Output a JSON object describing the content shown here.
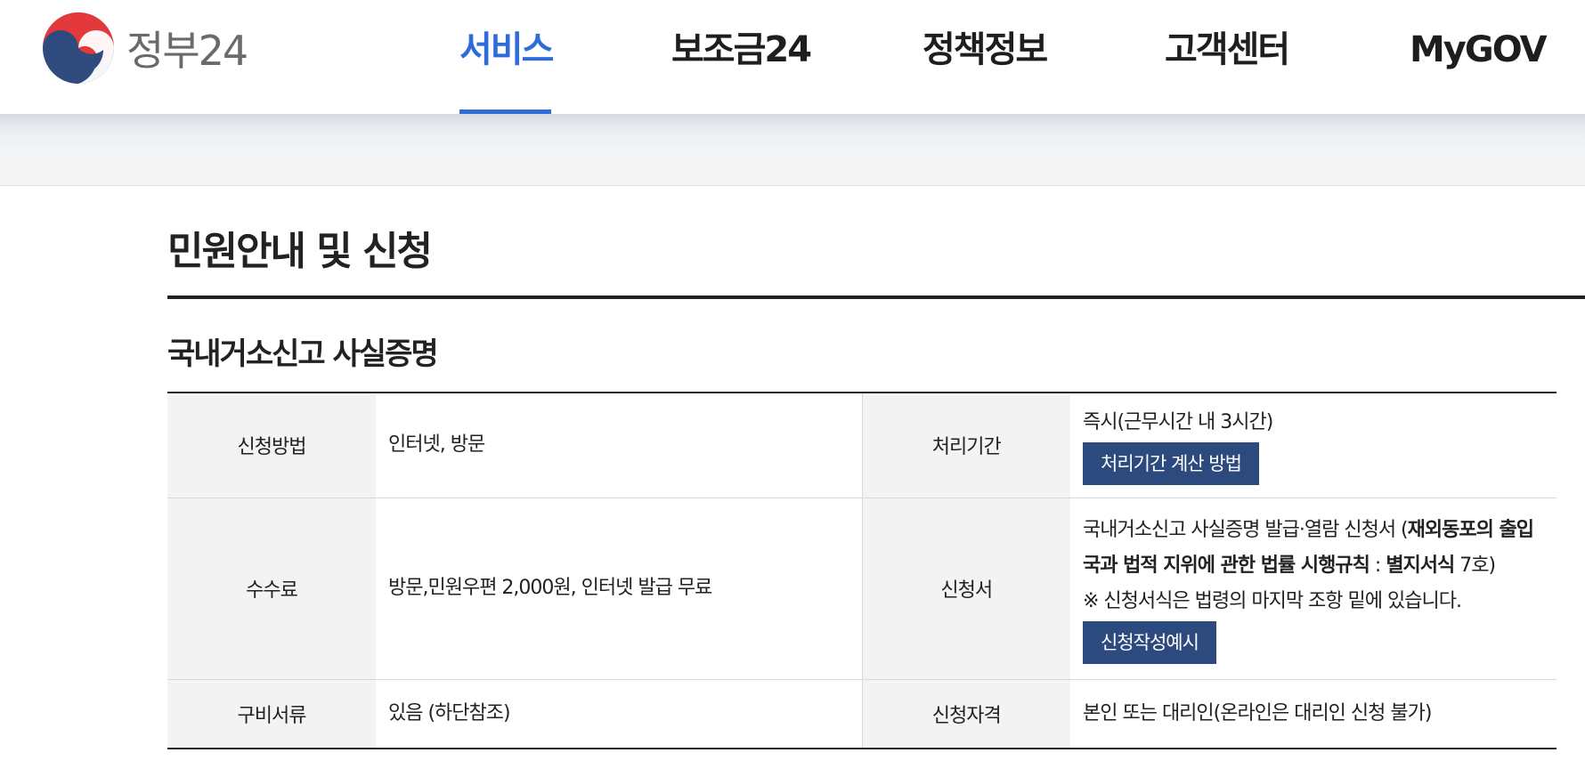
{
  "brand": {
    "name": "정부24"
  },
  "nav": [
    {
      "label": "서비스",
      "active": true
    },
    {
      "label": "보조금24",
      "active": false
    },
    {
      "label": "정책정보",
      "active": false
    },
    {
      "label": "고객센터",
      "active": false
    },
    {
      "label": "MyGOV",
      "active": false
    }
  ],
  "colors": {
    "accent": "#2e6dd9",
    "button": "#2d4a7e",
    "header_cell": "#f3f3f3"
  },
  "page_title": "민원안내 및 신청",
  "section_title": "국내거소신고 사실증명",
  "table": {
    "rows": [
      {
        "label_left": "신청방법",
        "value_left": "인터넷, 방문",
        "label_right": "처리기간",
        "value_right": "즉시(근무시간 내 3시간)",
        "button": "처리기간 계산 방법"
      },
      {
        "label_left": "수수료",
        "value_left": "방문,민원우편 2,000원, 인터넷 발급 무료",
        "label_right": "신청서",
        "value_right_prefix": "국내거소신고 사실증명 발급·열람 신청서 (",
        "value_right_bold1": "재외동포의 출입국과 법적 지위에 관한 법률 시행규칙",
        "value_right_mid": " : ",
        "value_right_bold2": "별지서식",
        "value_right_suffix": " 7호)",
        "note": "※ 신청서식은 법령의 마지막 조항 밑에 있습니다.",
        "button": "신청작성예시"
      },
      {
        "label_left": "구비서류",
        "value_left": "있음 (하단참조)",
        "label_right": "신청자격",
        "value_right": "본인 또는 대리인(온라인은 대리인 신청 불가)"
      }
    ]
  }
}
